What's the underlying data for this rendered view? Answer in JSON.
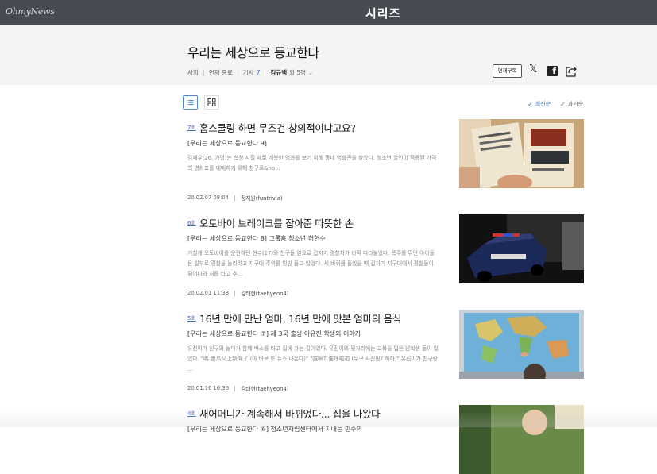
{
  "topbar": {
    "brand": "OhmyNews",
    "series_logo": "시리즈"
  },
  "header": {
    "title": "우리는 세상으로 등교한다",
    "category": "사회",
    "status": "연재 종료",
    "article_label": "기사",
    "article_count": "7",
    "author_main": "김규백",
    "author_rest": "외 5명",
    "subscribe_label": "연재구독"
  },
  "toolbar": {
    "sort_new": "최신순",
    "sort_old": "과거순"
  },
  "articles": [
    {
      "ep": "7회",
      "title": "홈스쿨링 하면 무조건 창의적이냐고요?",
      "subtitle": "[우리는 세상으로 등교한다 9]",
      "summary": "김재우(26, 가명)는 학창 시절 새로 개봉한 영화를 보기 위해 동네 영화관을 찾았다. 청소년 할인이 적용된 가격의 영화표를 예매하기 위해 창구로&nb...",
      "date": "20.02.07 08:04",
      "reporter": "정지원(funtrivia)"
    },
    {
      "ep": "6회",
      "title": "오토바이 브레이크를 잡아준 따뜻한 손",
      "subtitle": "[우리는 세상으로 등교한다 8] 그룹홈 청소년 허현수",
      "summary": "거칠게 오토바이를 운전하던 현수(17)와 친구들 옆으로 갑자기 경찰차가 바짝 따라붙었다. 폭주를 뛰던 아이들은 일부로 경찰을 놀리려고 지구대 주위를 빙빙 돌고 있었다. 세 바퀴쯤 돌았을 때 갑자기 지구대에서 경찰들이 튀어나와 처를 타고 추...",
      "date": "20.02.01 11:38",
      "reporter": "김태현(taehyeon4)"
    },
    {
      "ep": "5회",
      "title": "16년 만에 만난 엄마, 16년 만에 맛본 엄마의 음식",
      "subtitle": "[우리는 세상으로 등교한다 ⑦] 제 3국 출생 이유진 학생의 이야기",
      "summary": "유진이가 친구와 놀다가 함께 버스를 타고 집에 가는 길이었다. 유진이의 뒷자리에는 교복을 입은 남학생 둘이 있었다. \"嗎 傻瓜又上新聞了 (아 바보 또 뉴스 나온다)\" \"誰啊?(谁呼啦啦 (누구 시진핑? 하하)\" 유진이가 친구랑 ...",
      "date": "20.01.16 16:36",
      "reporter": "김태현(taehyeon4)"
    },
    {
      "ep": "4회",
      "title": "새어머니가 계속해서 바뀌었다... 집을 나왔다",
      "subtitle": "[우리는 세상으로 등교한다 ⑥] 청소년자립센터에서 지내는 민수의",
      "summary": "",
      "date": "",
      "reporter": ""
    }
  ],
  "colors": {
    "topbar": "#474a51",
    "header_bg": "#f4f4f4",
    "accent": "#3d7bd9"
  }
}
